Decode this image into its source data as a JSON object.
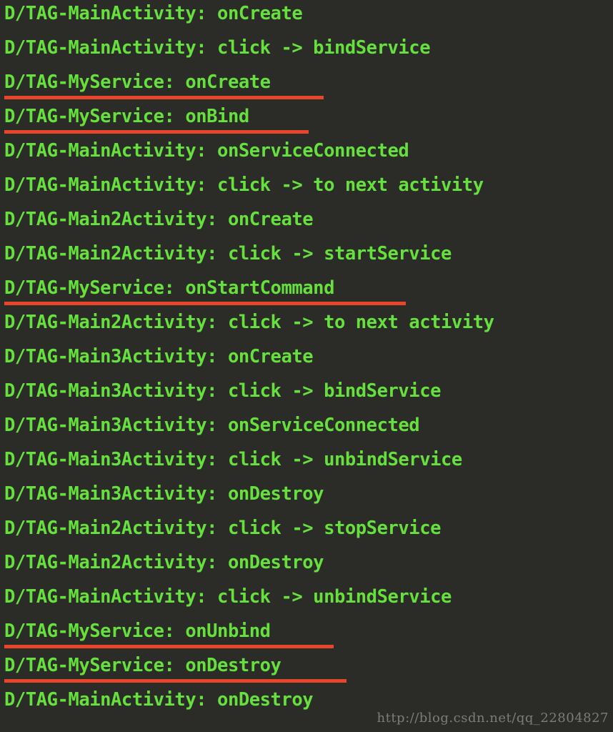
{
  "console": {
    "background_color": "#2b2b28",
    "text_color": "#66e03c",
    "underline_color": "#e8462b",
    "watermark_color": "#7d7d77",
    "lines": [
      {
        "text": "D/TAG-MainActivity: onCreate",
        "underlined": false,
        "underline_width": 0
      },
      {
        "text": "D/TAG-MainActivity: click -> bindService",
        "underlined": false,
        "underline_width": 0
      },
      {
        "text": "D/TAG-MyService: onCreate",
        "underlined": true,
        "underline_width": 447
      },
      {
        "text": "D/TAG-MyService: onBind",
        "underlined": true,
        "underline_width": 426
      },
      {
        "text": "D/TAG-MainActivity: onServiceConnected",
        "underlined": false,
        "underline_width": 0
      },
      {
        "text": "D/TAG-MainActivity: click -> to next activity",
        "underlined": false,
        "underline_width": 0
      },
      {
        "text": "D/TAG-Main2Activity: onCreate",
        "underlined": false,
        "underline_width": 0
      },
      {
        "text": "D/TAG-Main2Activity: click -> startService",
        "underlined": false,
        "underline_width": 0
      },
      {
        "text": "D/TAG-MyService: onStartCommand",
        "underlined": true,
        "underline_width": 562
      },
      {
        "text": "D/TAG-Main2Activity: click -> to next activity",
        "underlined": false,
        "underline_width": 0
      },
      {
        "text": "D/TAG-Main3Activity: onCreate",
        "underlined": false,
        "underline_width": 0
      },
      {
        "text": "D/TAG-Main3Activity: click -> bindService",
        "underlined": false,
        "underline_width": 0
      },
      {
        "text": "D/TAG-Main3Activity: onServiceConnected",
        "underlined": false,
        "underline_width": 0
      },
      {
        "text": "D/TAG-Main3Activity: click -> unbindService",
        "underlined": false,
        "underline_width": 0
      },
      {
        "text": "D/TAG-Main3Activity: onDestroy",
        "underlined": false,
        "underline_width": 0
      },
      {
        "text": "D/TAG-Main2Activity: click -> stopService",
        "underlined": false,
        "underline_width": 0
      },
      {
        "text": "D/TAG-Main2Activity: onDestroy",
        "underlined": false,
        "underline_width": 0
      },
      {
        "text": "D/TAG-MainActivity: click -> unbindService",
        "underlined": false,
        "underline_width": 0
      },
      {
        "text": "D/TAG-MyService: onUnbind",
        "underlined": true,
        "underline_width": 461
      },
      {
        "text": "D/TAG-MyService: onDestroy",
        "underlined": true,
        "underline_width": 479
      },
      {
        "text": "D/TAG-MainActivity: onDestroy",
        "underlined": false,
        "underline_width": 0
      }
    ],
    "watermark": "http://blog.csdn.net/qq_22804827"
  }
}
